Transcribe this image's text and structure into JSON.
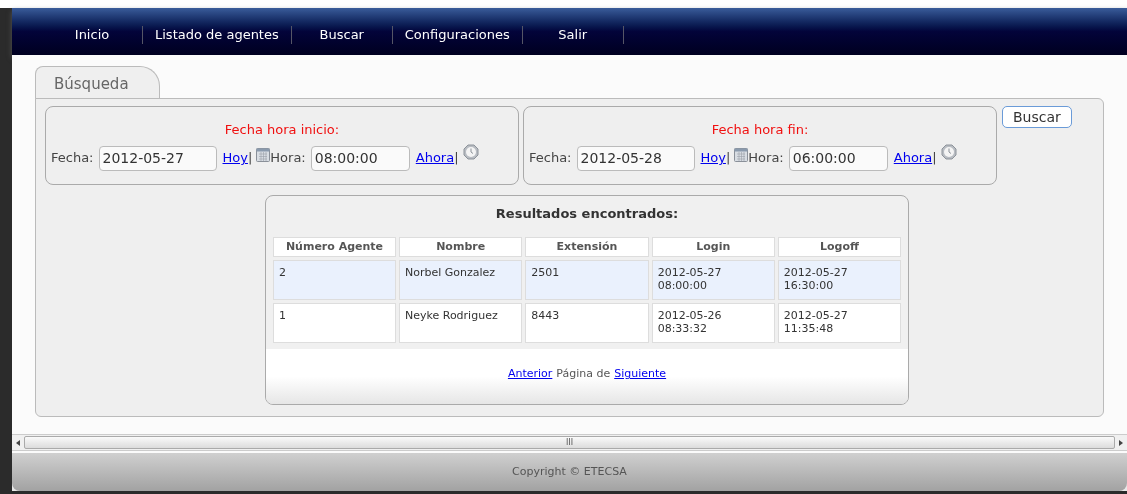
{
  "nav": [
    {
      "label": "Inicio"
    },
    {
      "label": "Listado de agentes"
    },
    {
      "label": "Buscar"
    },
    {
      "label": "Configuraciones"
    },
    {
      "label": "Salir"
    }
  ],
  "tab": {
    "label": "Búsqueda",
    "selected": true
  },
  "ranges": [
    {
      "title": "Fecha hora inicio:",
      "date_label": "Fecha:",
      "date": "2012-05-27",
      "today_link": "Hoy",
      "sep1": "|",
      "time_label": "Hora:",
      "time": "08:00:00",
      "now_link": "Ahora",
      "sep2": "|"
    },
    {
      "title": "Fecha hora fin:",
      "date_label": "Fecha:",
      "date": "2012-05-28",
      "today_link": "Hoy",
      "sep1": "|",
      "time_label": "Hora:",
      "time": "06:00:00",
      "now_link": "Ahora",
      "sep2": "|"
    }
  ],
  "search_button": "Buscar",
  "results": {
    "title": "Resultados encontrados:",
    "columns": [
      "Número Agente",
      "Nombre",
      "Extensión",
      "Login",
      "Logoff"
    ],
    "rows": [
      {
        "selected": true,
        "cells": [
          "2",
          "Norbel Gonzalez",
          "2501",
          "2012-05-27\n08:00:00",
          "2012-05-27\n16:30:00"
        ]
      },
      {
        "selected": false,
        "cells": [
          "1",
          "Neyke Rodriguez",
          "8443",
          "2012-05-26\n08:33:32",
          "2012-05-27\n11:35:48"
        ]
      }
    ],
    "pager": {
      "prev": "Anterior",
      "text": "Página de",
      "next": "Siguiente"
    }
  },
  "scrollbar_grip": "III",
  "footer": "Copyright © ETECSA"
}
